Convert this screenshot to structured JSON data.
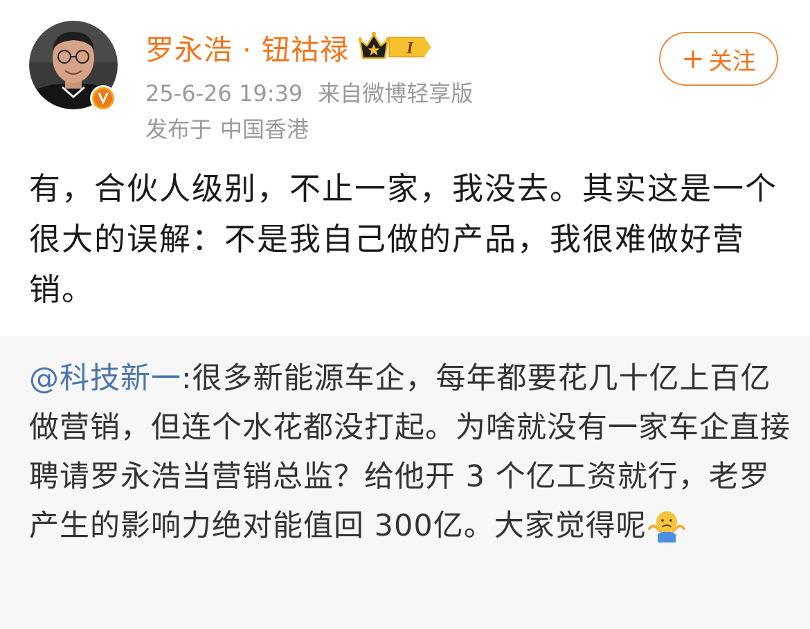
{
  "header": {
    "user_name": "罗永浩 · 钮祜禄",
    "vip_level": "I",
    "date": "25-6-26 19:39",
    "source": "来自微博轻享版",
    "location_prefix": "发布于",
    "location": "中国香港",
    "follow_label": "关注",
    "follow_plus": "+"
  },
  "post": {
    "text": "有，合伙人级别，不止一家，我没去。其实这是一个很大的误解：不是我自己做的产品，我很难做好营销。"
  },
  "repost": {
    "mention": "@科技新一",
    "text": ":很多新能源车企，每年都要花几十亿上百亿做营销，但连个水花都没打起。为啥就没有一家车企直接聘请罗永浩当营销总监？给他开 3 个亿工资就行，老罗产生的影响力绝对能值回 300亿。大家觉得呢",
    "emoji": "shrug-emoji"
  },
  "colors": {
    "name": "#f2741a",
    "meta": "#9a9a9a",
    "follow_border": "#f08a3a",
    "mention": "#4a77ab",
    "repost_bg": "#f7f7f7"
  }
}
